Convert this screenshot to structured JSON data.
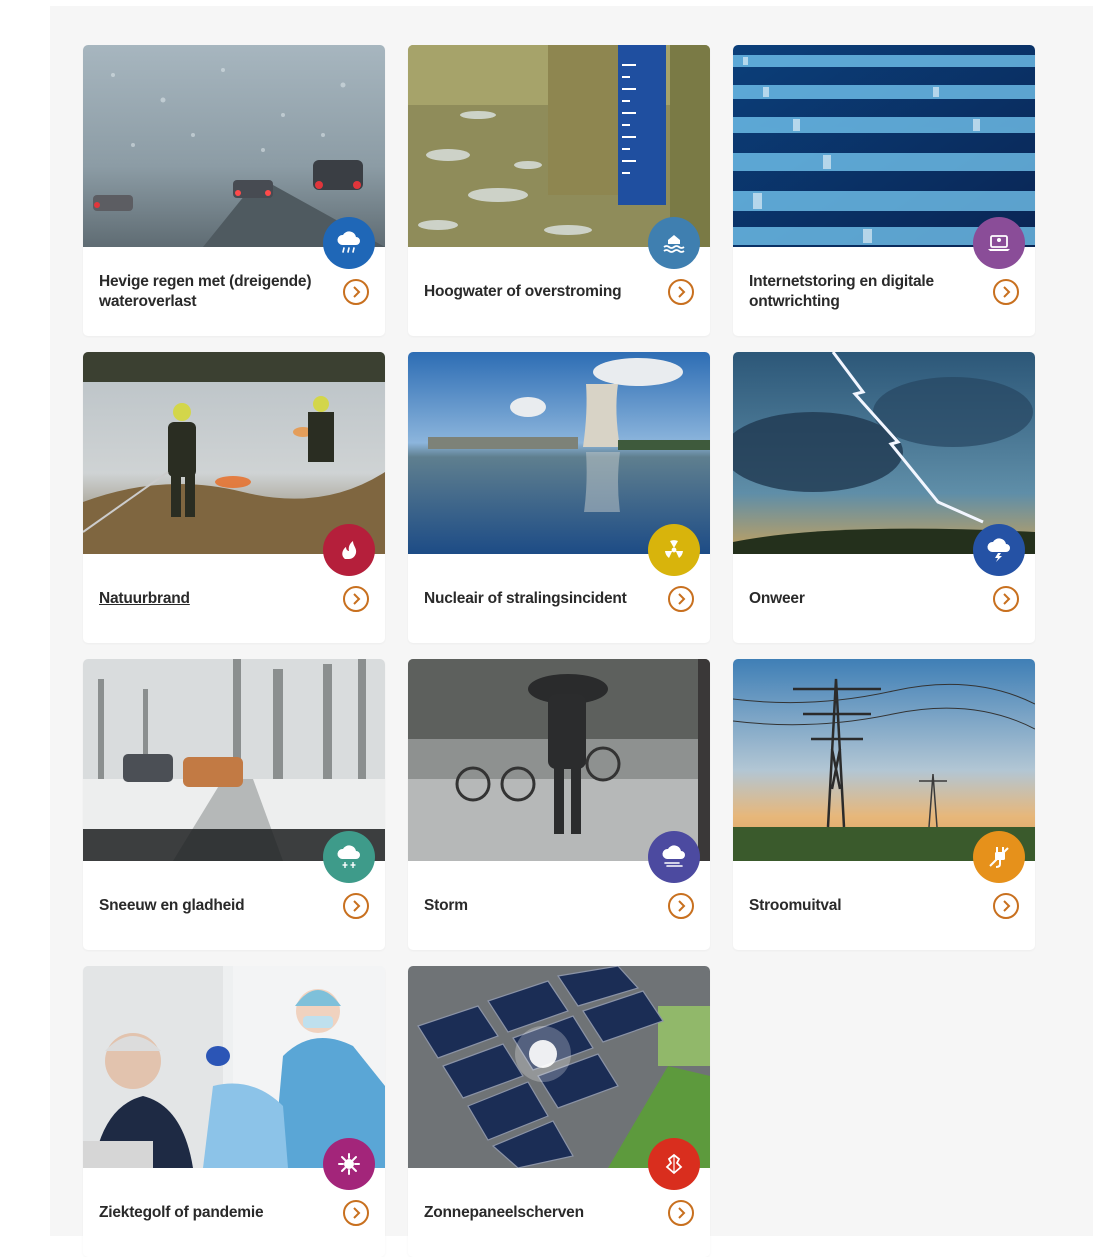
{
  "cards": [
    {
      "title": "Hevige regen met (dreigende) wateroverlast",
      "icon": "rain-cloud-icon",
      "badge_color": "#1f67b7"
    },
    {
      "title": "Hoogwater of overstroming",
      "icon": "flood-waves-icon",
      "badge_color": "#3f7fb0"
    },
    {
      "title": "Internetstoring en digitale ontwrichting",
      "icon": "laptop-alert-icon",
      "badge_color": "#8a4d98"
    },
    {
      "title": "Natuurbrand",
      "icon": "fire-icon",
      "badge_color": "#b51f3b"
    },
    {
      "title": "Nucleair of stralingsincident",
      "icon": "radiation-icon",
      "badge_color": "#d8b40c"
    },
    {
      "title": "Onweer",
      "icon": "thunder-cloud-icon",
      "badge_color": "#2552a5"
    },
    {
      "title": "Sneeuw en gladheid",
      "icon": "snow-cloud-icon",
      "badge_color": "#3e9b8a"
    },
    {
      "title": "Storm",
      "icon": "storm-cloud-icon",
      "badge_color": "#4c4aa0"
    },
    {
      "title": "Stroomuitval",
      "icon": "power-plug-icon",
      "badge_color": "#e6911b"
    },
    {
      "title": "Ziektegolf of pandemie",
      "icon": "virus-icon",
      "badge_color": "#a3257a"
    },
    {
      "title": "Zonnepaneelscherven",
      "icon": "solar-panel-shards-icon",
      "badge_color": "#d92e1e"
    }
  ],
  "colors": {
    "accent": "#c8701f",
    "panel_bg": "#f6f6f6",
    "card_bg": "#ffffff"
  }
}
